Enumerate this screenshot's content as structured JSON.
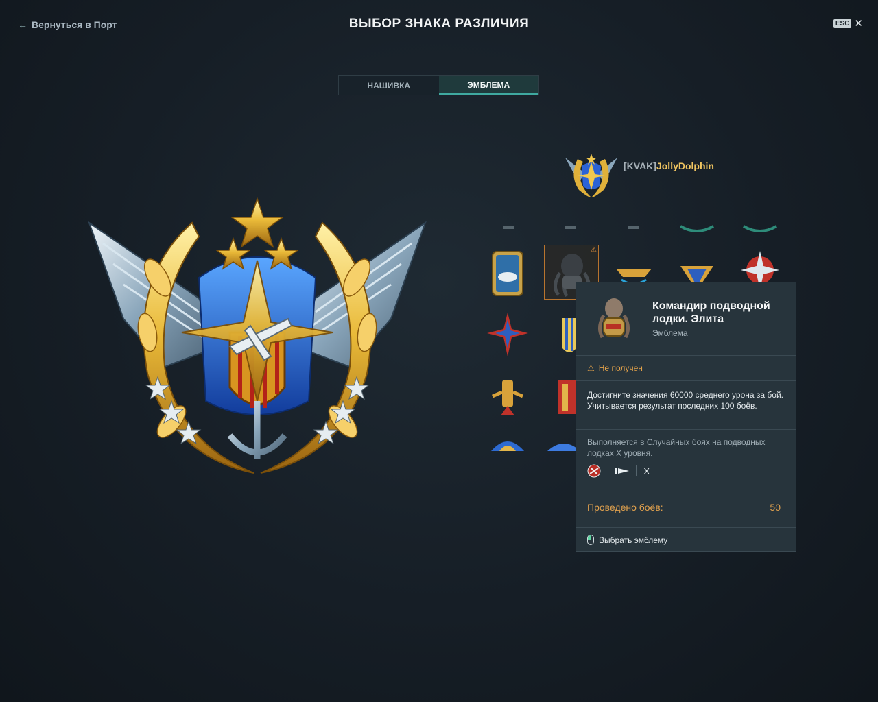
{
  "header": {
    "back_label": "Вернуться в Порт",
    "title": "ВЫБОР ЗНАКА РАЗЛИЧИЯ",
    "esc_label": "ESC"
  },
  "tabs": [
    {
      "label": "НАШИВКА",
      "active": false
    },
    {
      "label": "ЭМБЛЕМА",
      "active": true
    }
  ],
  "player": {
    "clan_tag": "[KVAK]",
    "nickname": "JollyDolphin"
  },
  "tooltip": {
    "title": "Командир подводной лодки. Элита",
    "subtitle": "Эмблема",
    "status": "Не получен",
    "description": "Достигните значения 60000 среднего урона за бой. Учитывается результат последних 100 боёв.",
    "condition": "Выполняется в Случайных боях на подводных лодках X уровня.",
    "tier": "X",
    "progress_label": "Проведено боёв:",
    "progress_value": "50",
    "hint": "Выбрать эмблему"
  },
  "colors": {
    "accent_teal": "#3fa9a0",
    "warning_orange": "#e0a04a",
    "nickname_gold": "#f0c561",
    "background": "#161e26"
  },
  "icons": {
    "back": "arrow-left-icon",
    "close": "close-icon",
    "warning": "warning-icon",
    "mouse": "mouse-left-click-icon",
    "submarine_type": "submarine-class-icon",
    "nation": "nation-flag-icon"
  }
}
